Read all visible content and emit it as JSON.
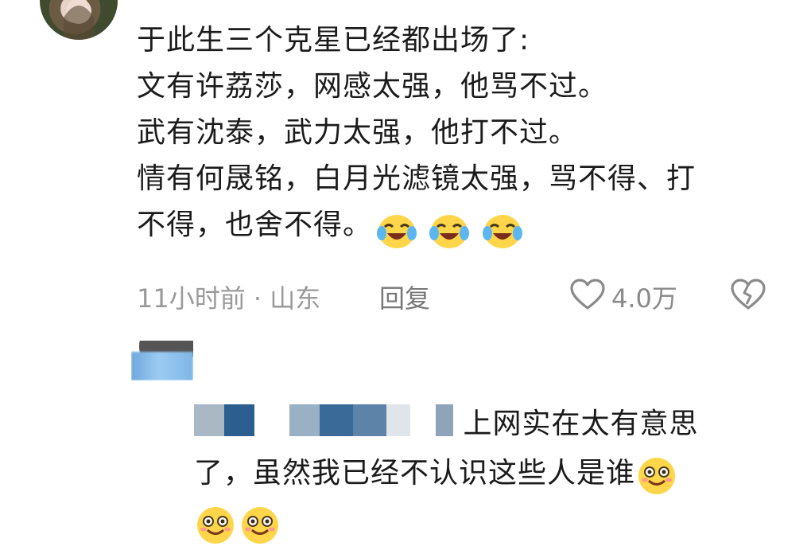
{
  "comment": {
    "lines": [
      "于此生三个克星已经都出场了:",
      "文有许荔莎，网感太强，他骂不过。",
      "武有沈泰，武力太强，他打不过。",
      "情有何晟铭，白月光滤镜太强，骂不得、打",
      "不得，也舍不得。"
    ],
    "emojis": [
      "crying-laughing-emoji",
      "crying-laughing-emoji",
      "crying-laughing-emoji"
    ]
  },
  "meta": {
    "time_location": "11小时前 · 山东",
    "reply_label": "回复",
    "like_count": "4.0万",
    "icons": [
      "heart-outline-icon",
      "broken-heart-icon"
    ]
  },
  "reply": {
    "line1_visible": "上网实在太有意思",
    "line2": "了，虽然我已经不认识这些人是谁",
    "emojis": [
      "smiling-emoji",
      "smiling-emoji",
      "smiling-emoji"
    ]
  },
  "colors": {
    "text": "#1b1b1b",
    "meta_gray": "#9a9a9a",
    "blur_blue": "#6fa8dc",
    "emoji_yellow": "#ffd64a"
  }
}
